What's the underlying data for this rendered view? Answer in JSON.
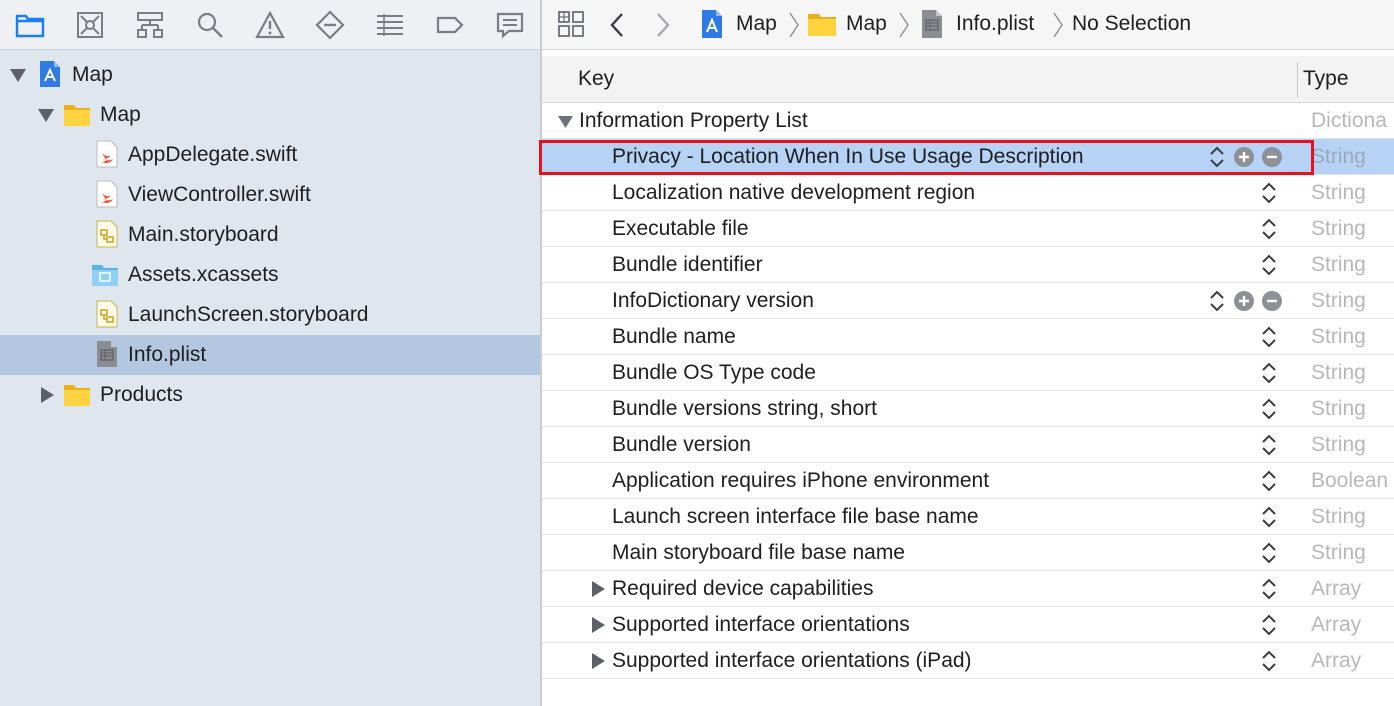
{
  "navigator": {
    "toolbar_icons": [
      "folder-icon",
      "source-control-icon",
      "hierarchy-icon",
      "search-icon",
      "warning-icon",
      "breakpoint-icon",
      "list-icon",
      "tag-icon",
      "comment-icon"
    ],
    "tree": [
      {
        "label": "Map",
        "icon": "project-icon",
        "expanded": true,
        "level": 0
      },
      {
        "label": "Map",
        "icon": "folder-icon",
        "expanded": true,
        "level": 1
      },
      {
        "label": "AppDelegate.swift",
        "icon": "swift-file-icon",
        "level": 2
      },
      {
        "label": "ViewController.swift",
        "icon": "swift-file-icon",
        "level": 2
      },
      {
        "label": "Main.storyboard",
        "icon": "storyboard-icon",
        "level": 2
      },
      {
        "label": "Assets.xcassets",
        "icon": "assets-folder-icon",
        "level": 2
      },
      {
        "label": "LaunchScreen.storyboard",
        "icon": "storyboard-icon",
        "level": 2
      },
      {
        "label": "Info.plist",
        "icon": "plist-file-icon",
        "level": 2,
        "selected": true
      },
      {
        "label": "Products",
        "icon": "folder-icon",
        "expanded": false,
        "level": 1
      }
    ]
  },
  "jumpbar": {
    "crumbs": [
      "Map",
      "Map",
      "Info.plist",
      "No Selection"
    ]
  },
  "editor": {
    "col_key": "Key",
    "col_type": "Type",
    "rows": [
      {
        "key": "Information Property List",
        "type": "Dictiona",
        "root": true
      },
      {
        "key": "Privacy - Location When In Use Usage Description",
        "type": "String",
        "selected": true
      },
      {
        "key": "Localization native development region",
        "type": "String"
      },
      {
        "key": "Executable file",
        "type": "String"
      },
      {
        "key": "Bundle identifier",
        "type": "String"
      },
      {
        "key": "InfoDictionary version",
        "type": "String",
        "controls": true
      },
      {
        "key": "Bundle name",
        "type": "String"
      },
      {
        "key": "Bundle OS Type code",
        "type": "String"
      },
      {
        "key": "Bundle versions string, short",
        "type": "String"
      },
      {
        "key": "Bundle version",
        "type": "String"
      },
      {
        "key": "Application requires iPhone environment",
        "type": "Boolean"
      },
      {
        "key": "Launch screen interface file base name",
        "type": "String"
      },
      {
        "key": "Main storyboard file base name",
        "type": "String"
      },
      {
        "key": "Required device capabilities",
        "type": "Array",
        "collapsed": true
      },
      {
        "key": "Supported interface orientations",
        "type": "Array",
        "collapsed": true
      },
      {
        "key": "Supported interface orientations (iPad)",
        "type": "Array",
        "collapsed": true
      }
    ]
  },
  "colors": {
    "selection_blue": "#b6d3f5",
    "navigator_selection": "#b4c7e0",
    "highlight_red": "#e8101a",
    "accent_blue": "#1a7ff2"
  }
}
